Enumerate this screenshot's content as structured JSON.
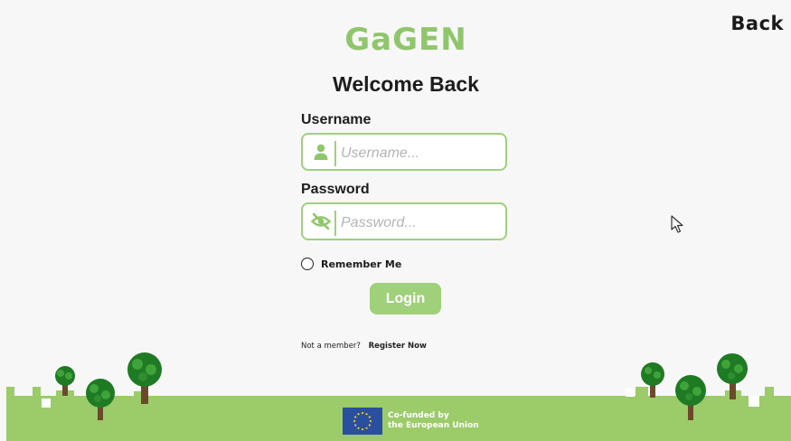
{
  "header": {
    "back_label": "Back"
  },
  "logo": {
    "text": "GaGEN"
  },
  "title": "Welcome Back",
  "form": {
    "username_label": "Username",
    "username_placeholder": "Username...",
    "password_label": "Password",
    "password_placeholder": "Password...",
    "remember_label": "Remember Me",
    "login_label": "Login"
  },
  "footer": {
    "not_member": "Not a member?",
    "register": "Register Now",
    "eu_line1": "Co-funded by",
    "eu_line2": "the European Union"
  },
  "colors": {
    "accent": "#9fd07a",
    "logo": "#8fc66a",
    "ground": "#9ccb6a",
    "eu_blue": "#2a4f9e"
  },
  "icons": [
    "user-icon",
    "eye-slash-icon",
    "mouse-cursor-icon",
    "eu-flag-icon",
    "tree-icon"
  ]
}
